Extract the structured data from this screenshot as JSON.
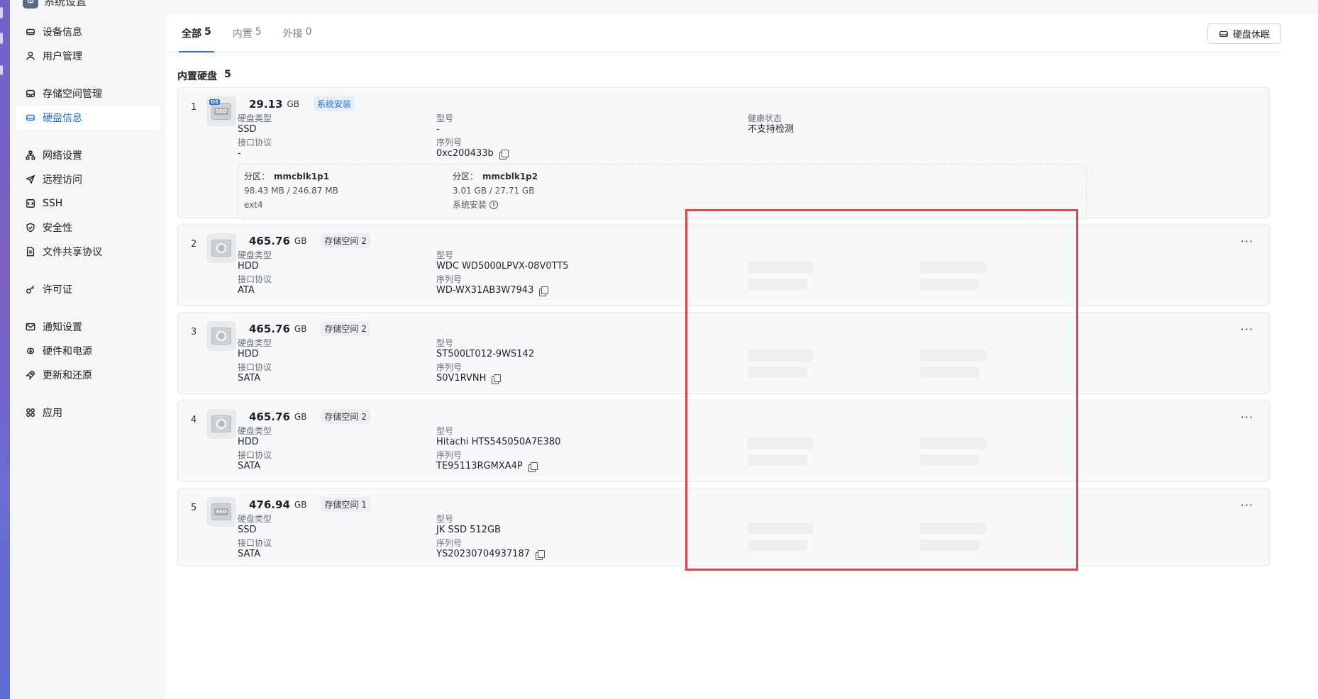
{
  "window": {
    "title": "系统设置",
    "app_icon": "gear-icon"
  },
  "sidebar": {
    "groups": [
      [
        {
          "label": "设备信息",
          "icon": "drive-icon"
        },
        {
          "label": "用户管理",
          "icon": "user-icon"
        }
      ],
      [
        {
          "label": "存储空间管理",
          "icon": "storage-icon"
        },
        {
          "label": "硬盘信息",
          "icon": "disk-icon",
          "active": true
        }
      ],
      [
        {
          "label": "网络设置",
          "icon": "network-icon"
        },
        {
          "label": "远程访问",
          "icon": "send-icon"
        },
        {
          "label": "SSH",
          "icon": "terminal-icon"
        },
        {
          "label": "安全性",
          "icon": "shield-icon"
        },
        {
          "label": "文件共享协议",
          "icon": "file-icon"
        }
      ],
      [
        {
          "label": "许可证",
          "icon": "key-icon"
        }
      ],
      [
        {
          "label": "通知设置",
          "icon": "mail-icon"
        },
        {
          "label": "硬件和电源",
          "icon": "power-icon"
        },
        {
          "label": "更新和还原",
          "icon": "rocket-icon"
        }
      ],
      [
        {
          "label": "应用",
          "icon": "apps-icon"
        }
      ]
    ]
  },
  "tabs": [
    {
      "label": "全部",
      "count": "5",
      "active": true
    },
    {
      "label": "内置",
      "count": "5"
    },
    {
      "label": "外接",
      "count": "0"
    }
  ],
  "sleep_button": "硬盘休眠",
  "section": {
    "title": "内置硬盘",
    "count": "5"
  },
  "labels": {
    "type": "硬盘类型",
    "model": "型号",
    "interface": "接口协议",
    "serial": "序列号",
    "health": "健康状态",
    "partition": "分区："
  },
  "disks": [
    {
      "index": "1",
      "capacity": "29.13",
      "unit": "GB",
      "tag": "系统安装",
      "tag_style": "blue",
      "kind": "SSD",
      "os": true,
      "type": "SSD",
      "model": "-",
      "interface": "-",
      "serial": "0xc200433b",
      "health": "不支持检测",
      "partitions": [
        {
          "name": "mmcblk1p1",
          "size": "98.43 MB / 246.87 MB",
          "fs": "ext4",
          "info": false
        },
        {
          "name": "mmcblk1p2",
          "size": "3.01 GB / 27.71 GB",
          "fs": "系统安装",
          "info": true
        }
      ]
    },
    {
      "index": "2",
      "capacity": "465.76",
      "unit": "GB",
      "tag": "存储空间 2",
      "kind": "HDD",
      "type": "HDD",
      "model": "WDC WD5000LPVX-08V0TT5",
      "interface": "ATA",
      "serial": "WD-WX31AB3W7943"
    },
    {
      "index": "3",
      "capacity": "465.76",
      "unit": "GB",
      "tag": "存储空间 2",
      "kind": "HDD",
      "type": "HDD",
      "model": "ST500LT012-9WS142",
      "interface": "SATA",
      "serial": "S0V1RVNH"
    },
    {
      "index": "4",
      "capacity": "465.76",
      "unit": "GB",
      "tag": "存储空间 2",
      "kind": "HDD",
      "type": "HDD",
      "model": "Hitachi HTS545050A7E380",
      "interface": "SATA",
      "serial": "TE95113RGMXA4P"
    },
    {
      "index": "5",
      "capacity": "476.94",
      "unit": "GB",
      "tag": "存储空间 1",
      "kind": "SSD",
      "type": "SSD",
      "model": "JK SSD 512GB",
      "interface": "SATA",
      "serial": "YS20230704937187"
    }
  ],
  "more_label": "···",
  "colors": {
    "accent": "#2a6ee8",
    "highlight": "#e0474c"
  }
}
